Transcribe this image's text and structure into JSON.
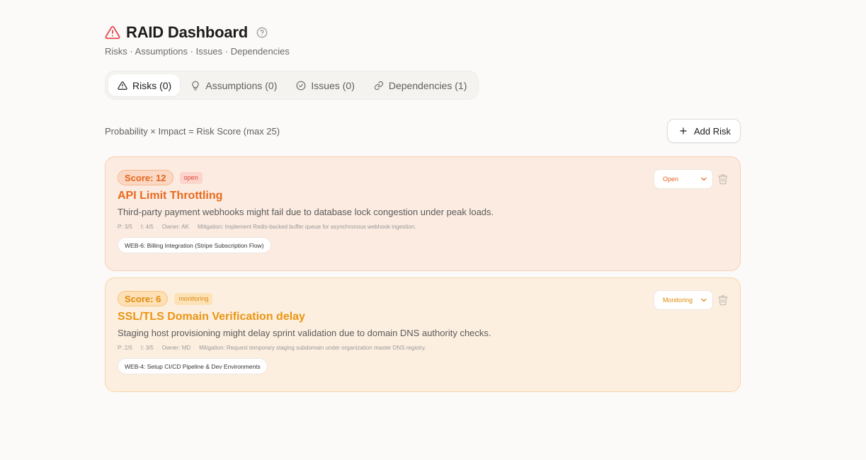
{
  "header": {
    "title": "RAID Dashboard",
    "subtitle": "Risks · Assumptions · Issues · Dependencies",
    "title_icon": "alert-triangle-icon",
    "help_icon": "help-circle-icon"
  },
  "tabs": [
    {
      "label": "Risks (0)",
      "icon": "alert-triangle-icon",
      "active": true
    },
    {
      "label": "Assumptions (0)",
      "icon": "lightbulb-icon",
      "active": false
    },
    {
      "label": "Issues (0)",
      "icon": "check-circle-icon",
      "active": false
    },
    {
      "label": "Dependencies (1)",
      "icon": "link-icon",
      "active": false
    }
  ],
  "toolbar": {
    "formula": "Probability × Impact = Risk Score (max 25)",
    "add_label": "Add Risk"
  },
  "risks": [
    {
      "score_label": "Score: 12",
      "status_badge": "open",
      "title": "API Limit Throttling",
      "description": "Third-party payment webhooks might fail due to database lock congestion under peak loads.",
      "probability": "P: 3/5",
      "impact": "I: 4/5",
      "owner": "Owner: AK",
      "mitigation": "Mitigation: Implement Redis-backed buffer queue for asynchronous webhook ingestion.",
      "tag": "WEB-6: Billing Integration (Stripe Subscription Flow)",
      "status_select": "Open",
      "color": "#e86a1f"
    },
    {
      "score_label": "Score: 6",
      "status_badge": "monitoring",
      "title": "SSL/TLS Domain Verification delay",
      "description": "Staging host provisioning might delay sprint validation due to domain DNS authority checks.",
      "probability": "P: 2/5",
      "impact": "I: 3/5",
      "owner": "Owner: MD",
      "mitigation": "Mitigation: Request temporary staging subdomain under organization master DNS registry.",
      "tag": "WEB-4: Setup CI/CD Pipeline & Dev Environments",
      "status_select": "Monitoring",
      "color": "#ea9512"
    }
  ],
  "colors": {
    "alert_red": "#e5484d",
    "page_bg": "#fbfaf8"
  }
}
